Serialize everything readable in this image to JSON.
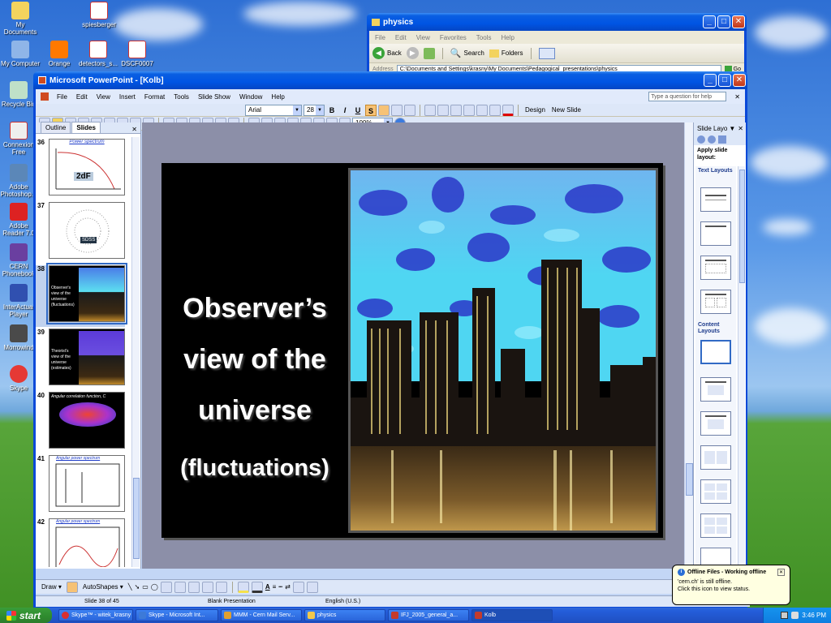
{
  "desktop": {
    "icons": [
      {
        "name": "my-documents",
        "label": "My Documents"
      },
      {
        "name": "spiesberger",
        "label": "spiesberger"
      },
      {
        "name": "my-computer",
        "label": "My Computer"
      },
      {
        "name": "orange",
        "label": "Orange"
      },
      {
        "name": "detectors",
        "label": "detectors_s..."
      },
      {
        "name": "dscf0007",
        "label": "DSCF0007"
      },
      {
        "name": "recycle-bin",
        "label": "Recycle Bin"
      },
      {
        "name": "connexion",
        "label": "Connexion Free"
      },
      {
        "name": "adobe-photoshop",
        "label": "Adobe Photoshop..."
      },
      {
        "name": "adobe-reader",
        "label": "Adobe Reader 7.0"
      },
      {
        "name": "cern-phonebook",
        "label": "CERN Phonebook"
      },
      {
        "name": "interactual",
        "label": "InterActual Player"
      },
      {
        "name": "morrowind",
        "label": "Morrowind"
      },
      {
        "name": "skype",
        "label": "Skype"
      }
    ]
  },
  "explorer": {
    "title": "physics",
    "menu": [
      "File",
      "Edit",
      "View",
      "Favorites",
      "Tools",
      "Help"
    ],
    "back_label": "Back",
    "search_label": "Search",
    "folders_label": "Folders",
    "address_label": "Address",
    "address_value": "C:\\Documents and Settings\\krasny\\My Documents\\Pedagogical_presentations\\physics",
    "go_label": "Go"
  },
  "ppt": {
    "title": "Microsoft PowerPoint - [Kolb]",
    "menu": [
      "File",
      "Edit",
      "View",
      "Insert",
      "Format",
      "Tools",
      "Slide Show",
      "Window",
      "Help"
    ],
    "help_placeholder": "Type a question for help",
    "font_name": "Arial",
    "font_size": "28",
    "zoom": "100%",
    "design_label": "Design",
    "new_slide_label": "New Slide",
    "tabs": {
      "outline": "Outline",
      "slides": "Slides"
    },
    "thumbnails": [
      {
        "num": "36",
        "title": "Power spectrum",
        "badge": "2dF"
      },
      {
        "num": "37",
        "title": "",
        "badge": "SDSS"
      },
      {
        "num": "38",
        "title": "Observer's view of the universe (fluctuations)"
      },
      {
        "num": "39",
        "title": "Theorist's view of the universe (estimates)"
      },
      {
        "num": "40",
        "title": "Angular correlation function, C"
      },
      {
        "num": "41",
        "title": "Angular power spectrum"
      },
      {
        "num": "42",
        "title": "Angular power spectrum"
      }
    ],
    "slide": {
      "lines": [
        "Observer’s",
        "view of the",
        "universe",
        "(fluctuations)"
      ]
    },
    "task_pane": {
      "title": "Slide Layo",
      "apply_label": "Apply slide layout:",
      "text_layouts": "Text Layouts",
      "content_layouts": "Content Layouts"
    },
    "drawing": {
      "draw_label": "Draw",
      "autoshapes_label": "AutoShapes"
    },
    "status": {
      "slide": "Slide 38 of 45",
      "design": "Blank Presentation",
      "language": "English (U.S.)"
    }
  },
  "balloon": {
    "title": "Offline Files - Working offline",
    "line1": "'cern.ch' is still offline.",
    "line2": "Click this icon to view status."
  },
  "taskbar": {
    "start": "start",
    "tasks": [
      {
        "label": "Skype™ - witek_krasny",
        "color": "#d93030"
      },
      {
        "label": "Skype - Microsoft Int...",
        "color": "#3d7ad8"
      },
      {
        "label": "MMM - Cern Mail Serv...",
        "color": "#e0a030"
      },
      {
        "label": "physics",
        "color": "#f2c84b"
      },
      {
        "label": "IFJ_2005_general_a...",
        "color": "#c43b2b"
      },
      {
        "label": "Kolb",
        "color": "#c43b2b"
      }
    ],
    "clock": "3:46 PM"
  }
}
